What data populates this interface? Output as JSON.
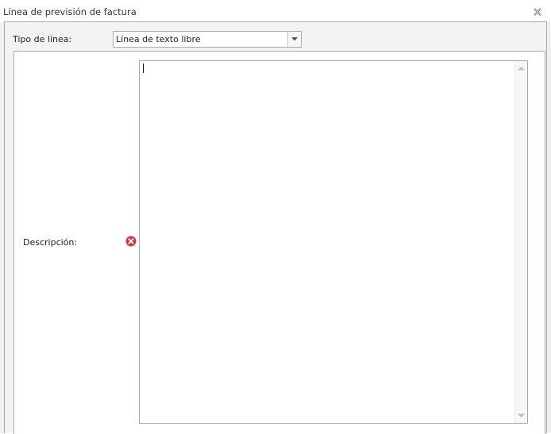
{
  "window": {
    "title": "Línea de previsión de factura"
  },
  "form": {
    "type_label": "Tipo de línea:",
    "type_value": "Línea de texto libre",
    "description_label": "Descripción:",
    "description_value": ""
  },
  "colors": {
    "border": "#a9a9a9",
    "error": "#d9324b",
    "background": "#f3f3f3"
  },
  "icons": {
    "close": "close-icon",
    "dropdown": "chevron-down-icon",
    "error": "error-icon",
    "scroll_up": "scroll-up-icon",
    "scroll_down": "scroll-down-icon"
  }
}
